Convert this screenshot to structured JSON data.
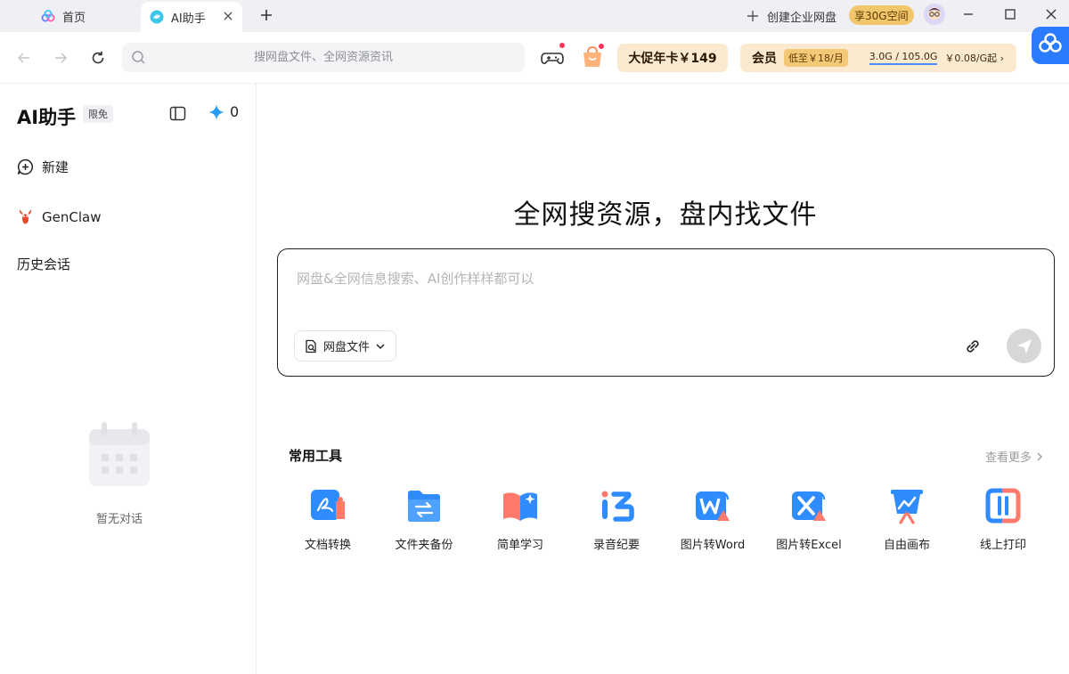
{
  "tabs": {
    "home_label": "首页",
    "active_label": "AI助手"
  },
  "titlebar": {
    "create_enterprise": "创建企业网盘",
    "storage_badge": "享30G空间"
  },
  "toolbar": {
    "search_placeholder": "搜网盘文件、全网资源资讯",
    "promo_label": "大促年卡￥149",
    "vip_title": "会员",
    "vip_low": "低至￥18/月",
    "vip_usage": "3.0G / 105.0G",
    "vip_price": "￥0.08/G起 ›"
  },
  "sidebar": {
    "title": "AI助手",
    "free_tag": "限免",
    "star_count": "0",
    "items": [
      {
        "label": "新建"
      },
      {
        "label": "GenClaw"
      },
      {
        "label": "历史会话"
      }
    ],
    "empty_text": "暂无对话"
  },
  "main": {
    "heading": "全网搜资源，盘内找文件",
    "input_placeholder": "网盘&全网信息搜索、AI创作样样都可以",
    "scope_label": "网盘文件",
    "tools_title": "常用工具",
    "see_more": "查看更多",
    "tools": [
      {
        "label": "文档转换",
        "icon": "pdf-convert-icon"
      },
      {
        "label": "文件夹备份",
        "icon": "folder-backup-icon"
      },
      {
        "label": "简单学习",
        "icon": "book-icon"
      },
      {
        "label": "录音纪要",
        "icon": "record-notes-icon"
      },
      {
        "label": "图片转Word",
        "icon": "image-to-word-icon"
      },
      {
        "label": "图片转Excel",
        "icon": "image-to-excel-icon"
      },
      {
        "label": "自由画布",
        "icon": "canvas-icon"
      },
      {
        "label": "线上打印",
        "icon": "print-icon"
      }
    ]
  },
  "colors": {
    "accent": "#2b7bff",
    "promo_bg": "#fbead0",
    "badge_gold": "#f2c66b"
  }
}
